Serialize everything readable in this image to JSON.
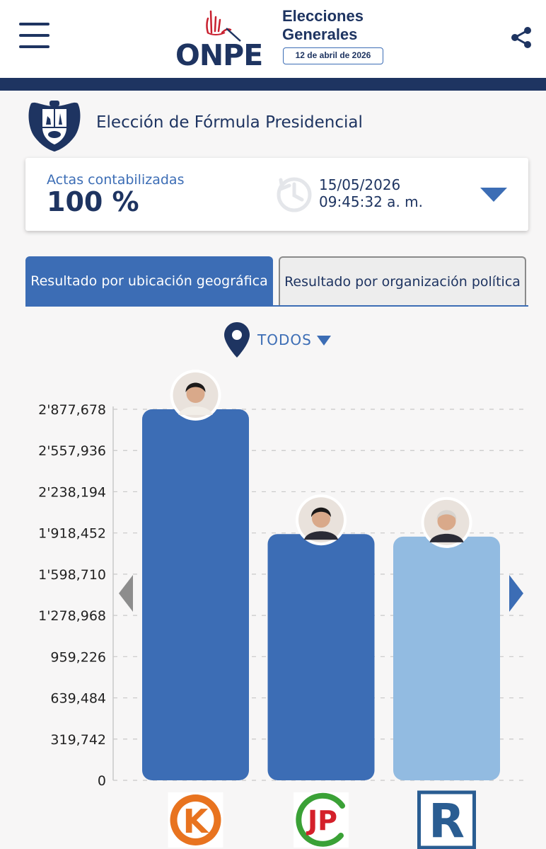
{
  "header": {
    "logo_text": "ONPE",
    "election_title_line1": "Elecciones",
    "election_title_line2": "Generales",
    "election_date": "12 de abril de 2026",
    "icons": {
      "menu": "hamburger-menu-icon",
      "share": "share-icon"
    }
  },
  "page": {
    "title": "Elección de Fórmula Presidencial",
    "emblem": "peru-coat-of-arms-icon"
  },
  "status": {
    "label": "Actas contabilizadas",
    "value": "100 %",
    "date": "15/05/2026",
    "time": "09:45:32 a. m."
  },
  "tabs": [
    {
      "label": "Resultado por ubicación geográfica",
      "active": true
    },
    {
      "label": "Resultado por organización política",
      "active": false
    }
  ],
  "location": {
    "label": "TODOS"
  },
  "colors": {
    "navy": "#1e3461",
    "blue": "#3c6db5",
    "light_blue": "#92bbe1",
    "accent_red": "#c8202f"
  },
  "chart_data": {
    "type": "bar",
    "categories": [
      "K",
      "JP",
      "R"
    ],
    "values": [
      2877678,
      1910000,
      1890000
    ],
    "yticks": [
      "0",
      "319,742",
      "639,484",
      "959,226",
      "1'278,968",
      "1'598,710",
      "1'918,452",
      "2'238,194",
      "2'557,936",
      "2'877,678"
    ],
    "ylim": [
      0,
      2877678
    ],
    "grid": true,
    "bar_colors": [
      "#3c6db5",
      "#3c6db5",
      "#92bbe1"
    ],
    "party_logos": [
      {
        "letter": "K",
        "icon": "fuerza-popular-logo"
      },
      {
        "letter": "JP",
        "icon": "juntos-por-el-peru-logo"
      },
      {
        "letter": "R",
        "icon": "renovacion-popular-logo"
      }
    ],
    "candidate_photos": [
      "candidate-avatar-1",
      "candidate-avatar-2",
      "candidate-avatar-3"
    ]
  }
}
